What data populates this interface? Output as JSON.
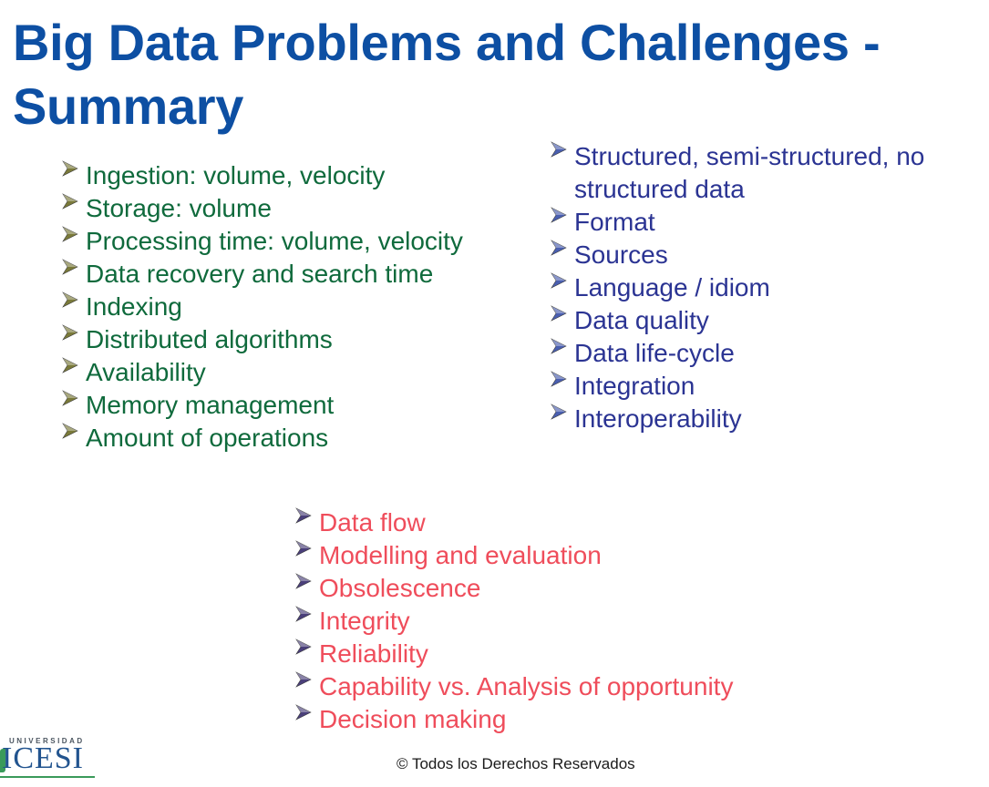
{
  "slide": {
    "title": "Big Data Problems and Challenges - Summary",
    "footer": "© Todos los Derechos Reservados"
  },
  "logo": {
    "top_text": "UNIVERSIDAD",
    "name": "ICESI"
  },
  "colors": {
    "title": "#0d4fa3",
    "green_list": "#0f6a3c",
    "blue_list": "#2b3493",
    "red_list": "#ef4d5b",
    "bullet_green": "#7a7a3a",
    "bullet_blue": "#4a5fb0",
    "bullet_red": "#4a3f7a"
  },
  "lists": {
    "green": [
      "Ingestion: volume, velocity",
      "Storage: volume",
      "Processing time: volume, velocity",
      "Data recovery and search time",
      "Indexing",
      "Distributed algorithms",
      "Availability",
      "Memory management",
      "Amount of operations"
    ],
    "blue": [
      "Structured, semi-structured, no structured data",
      "Format",
      "Sources",
      "Language / idiom",
      "Data quality",
      "Data life-cycle",
      "Integration",
      "Interoperability"
    ],
    "red": [
      "Data flow",
      "Modelling and evaluation",
      "Obsolescence",
      "Integrity",
      "Reliability",
      "Capability vs. Analysis of opportunity",
      "Decision making"
    ]
  }
}
